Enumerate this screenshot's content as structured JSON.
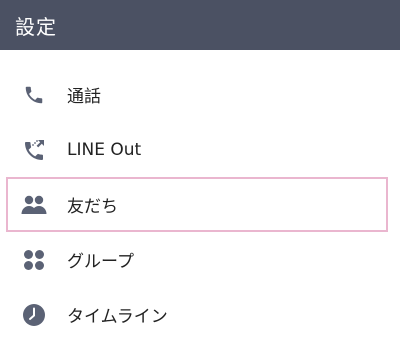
{
  "header": {
    "title": "設定"
  },
  "menu": {
    "items": [
      {
        "label": "通話",
        "icon": "phone-icon"
      },
      {
        "label": "LINE Out",
        "icon": "phone-out-icon"
      },
      {
        "label": "友だち",
        "icon": "friends-icon",
        "selected": true
      },
      {
        "label": "グループ",
        "icon": "group-icon"
      },
      {
        "label": "タイムライン",
        "icon": "clock-icon"
      }
    ]
  },
  "colors": {
    "header_bg": "#4b5163",
    "icon": "#5b6275",
    "highlight_border": "#eab6cf"
  }
}
